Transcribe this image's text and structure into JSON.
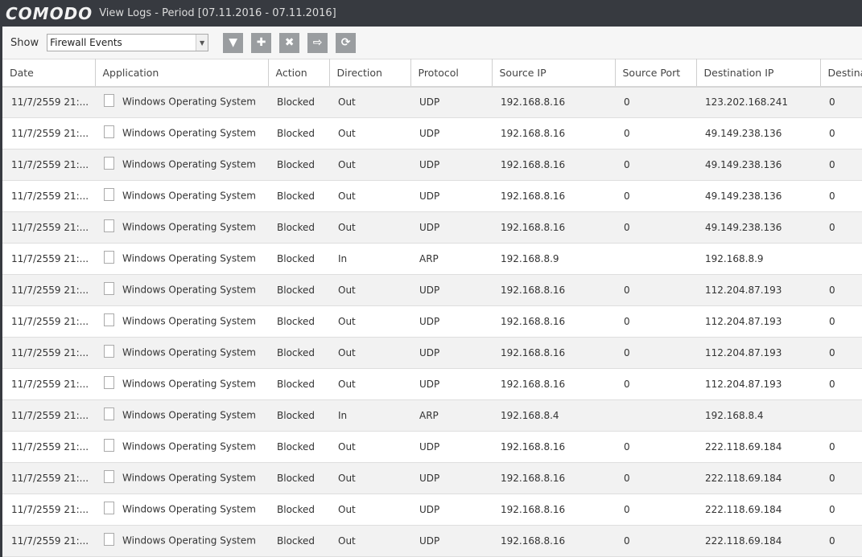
{
  "titlebar": {
    "logo": "COMODO",
    "title": "View Logs - Period [07.11.2016 - 07.11.2016]"
  },
  "toolbar": {
    "show_label": "Show",
    "select_value": "Firewall Events",
    "buttons": [
      {
        "icon": "filter-icon",
        "glyph": "▼"
      },
      {
        "icon": "plus-icon",
        "glyph": "✚"
      },
      {
        "icon": "delete-icon",
        "glyph": "✖"
      },
      {
        "icon": "export-icon",
        "glyph": "⇨"
      },
      {
        "icon": "refresh-icon",
        "glyph": "⟳"
      }
    ]
  },
  "columns": [
    "Date",
    "Application",
    "Action",
    "Direction",
    "Protocol",
    "Source IP",
    "Source Port",
    "Destination IP",
    "Destina"
  ],
  "rows": [
    [
      "11/7/2559 21:...",
      "Windows Operating System",
      "Blocked",
      "Out",
      "UDP",
      "192.168.8.16",
      "0",
      "123.202.168.241",
      "0"
    ],
    [
      "11/7/2559 21:...",
      "Windows Operating System",
      "Blocked",
      "Out",
      "UDP",
      "192.168.8.16",
      "0",
      "49.149.238.136",
      "0"
    ],
    [
      "11/7/2559 21:...",
      "Windows Operating System",
      "Blocked",
      "Out",
      "UDP",
      "192.168.8.16",
      "0",
      "49.149.238.136",
      "0"
    ],
    [
      "11/7/2559 21:...",
      "Windows Operating System",
      "Blocked",
      "Out",
      "UDP",
      "192.168.8.16",
      "0",
      "49.149.238.136",
      "0"
    ],
    [
      "11/7/2559 21:...",
      "Windows Operating System",
      "Blocked",
      "Out",
      "UDP",
      "192.168.8.16",
      "0",
      "49.149.238.136",
      "0"
    ],
    [
      "11/7/2559 21:...",
      "Windows Operating System",
      "Blocked",
      "In",
      "ARP",
      "192.168.8.9",
      "",
      "192.168.8.9",
      ""
    ],
    [
      "11/7/2559 21:...",
      "Windows Operating System",
      "Blocked",
      "Out",
      "UDP",
      "192.168.8.16",
      "0",
      "112.204.87.193",
      "0"
    ],
    [
      "11/7/2559 21:...",
      "Windows Operating System",
      "Blocked",
      "Out",
      "UDP",
      "192.168.8.16",
      "0",
      "112.204.87.193",
      "0"
    ],
    [
      "11/7/2559 21:...",
      "Windows Operating System",
      "Blocked",
      "Out",
      "UDP",
      "192.168.8.16",
      "0",
      "112.204.87.193",
      "0"
    ],
    [
      "11/7/2559 21:...",
      "Windows Operating System",
      "Blocked",
      "Out",
      "UDP",
      "192.168.8.16",
      "0",
      "112.204.87.193",
      "0"
    ],
    [
      "11/7/2559 21:...",
      "Windows Operating System",
      "Blocked",
      "In",
      "ARP",
      "192.168.8.4",
      "",
      "192.168.8.4",
      ""
    ],
    [
      "11/7/2559 21:...",
      "Windows Operating System",
      "Blocked",
      "Out",
      "UDP",
      "192.168.8.16",
      "0",
      "222.118.69.184",
      "0"
    ],
    [
      "11/7/2559 21:...",
      "Windows Operating System",
      "Blocked",
      "Out",
      "UDP",
      "192.168.8.16",
      "0",
      "222.118.69.184",
      "0"
    ],
    [
      "11/7/2559 21:...",
      "Windows Operating System",
      "Blocked",
      "Out",
      "UDP",
      "192.168.8.16",
      "0",
      "222.118.69.184",
      "0"
    ],
    [
      "11/7/2559 21:...",
      "Windows Operating System",
      "Blocked",
      "Out",
      "UDP",
      "192.168.8.16",
      "0",
      "222.118.69.184",
      "0"
    ]
  ]
}
